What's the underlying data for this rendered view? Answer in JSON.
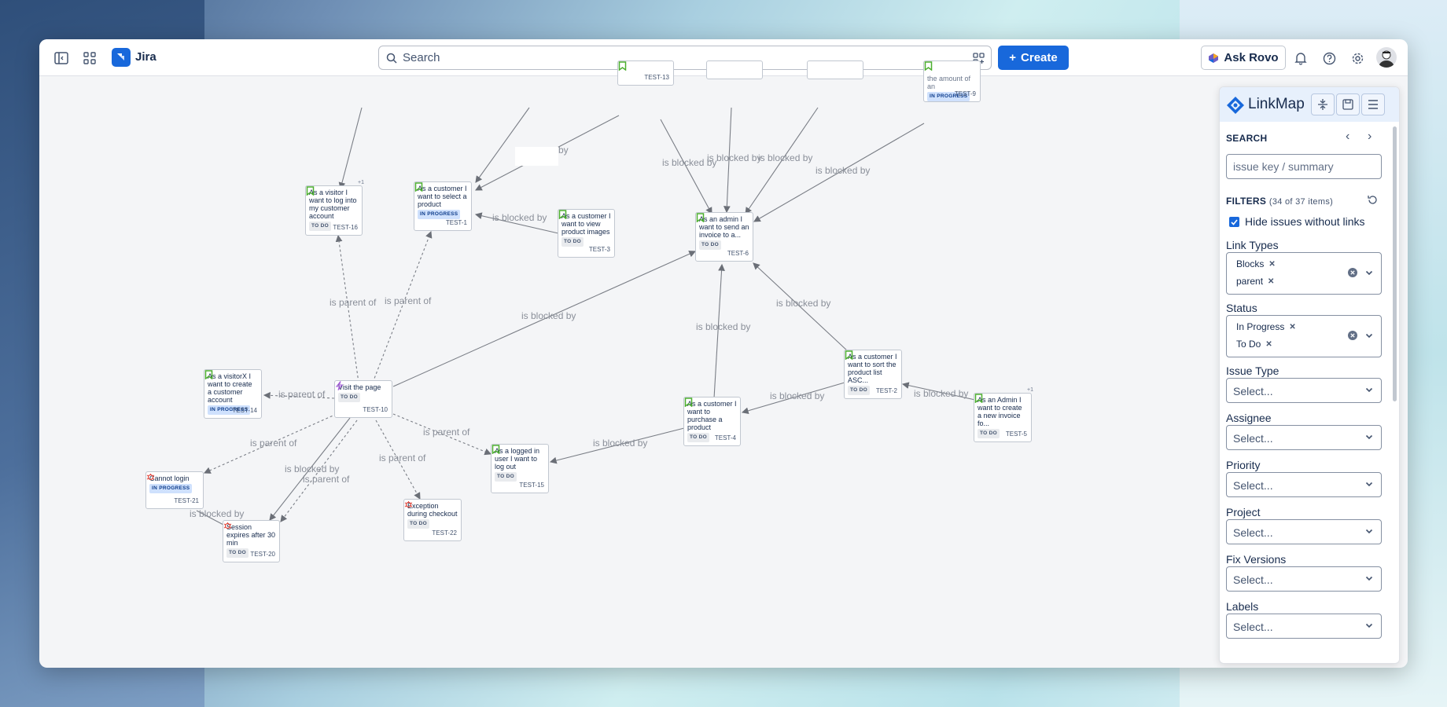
{
  "app": {
    "name": "Jira",
    "search_placeholder": "Search",
    "create_label": "Create",
    "ask_rovo_label": "Ask Rovo",
    "accent": "#1868db"
  },
  "icons": {
    "sidebar_toggle": "sidebar-toggle-icon",
    "apps": "app-switcher-icon",
    "search": "search-icon",
    "filter": "search-filter-icon",
    "notifications": "bell-icon",
    "help": "help-icon",
    "settings": "gear-icon"
  },
  "graph": {
    "nodes": [
      {
        "key": "TEST-13",
        "title": "",
        "status": ""
      },
      {
        "key": "TEST-9",
        "title": "the amount of an",
        "status": "IN PROGRESS"
      },
      {
        "key": "TEST-16",
        "title": "As a visitor I want to log into my customer account",
        "status": "TO DO",
        "badge": "+1"
      },
      {
        "key": "TEST-1",
        "title": "As a customer I want to select a product",
        "status": "IN PROGRESS"
      },
      {
        "key": "TEST-3",
        "title": "As a customer I want to view product images",
        "status": "TO DO"
      },
      {
        "key": "TEST-6",
        "title": "As an admin I want to send an invoice to a...",
        "status": "TO DO"
      },
      {
        "key": "TEST-14",
        "title": "As a visitorX I want to create a customer account",
        "status": "IN PROGRESS"
      },
      {
        "key": "TEST-10",
        "title": "Visit the page",
        "status": "TO DO"
      },
      {
        "key": "TEST-2",
        "title": "As a customer I want to sort the product list ASC...",
        "status": "TO DO"
      },
      {
        "key": "TEST-4",
        "title": "As a customer I want to purchase a product",
        "status": "TO DO"
      },
      {
        "key": "TEST-5",
        "title": "As an Admin I want to create a new invoice fo...",
        "status": "TO DO",
        "badge": "+1"
      },
      {
        "key": "TEST-15",
        "title": "As a logged in user I want to log out",
        "status": "TO DO"
      },
      {
        "key": "TEST-21",
        "title": "Cannot login",
        "status": "IN PROGRESS"
      },
      {
        "key": "TEST-20",
        "title": "Session expires after 30 min",
        "status": "TO DO"
      },
      {
        "key": "TEST-22",
        "title": "Exception during checkout",
        "status": "TO DO"
      }
    ],
    "edge_labels": {
      "blocked": "is blocked by",
      "parent": "is parent of",
      "by": "by"
    }
  },
  "linkmap": {
    "title": "LinkMap",
    "search_label": "SEARCH",
    "search_placeholder": "issue key / summary",
    "filters_label": "FILTERS",
    "filters_count": "(34 of 37 items)",
    "hide_without_links": "Hide issues without links",
    "link_types_label": "Link Types",
    "link_types": [
      "Blocks",
      "parent"
    ],
    "status_label": "Status",
    "statuses": [
      "In Progress",
      "To Do"
    ],
    "issue_type_label": "Issue Type",
    "assignee_label": "Assignee",
    "priority_label": "Priority",
    "project_label": "Project",
    "fix_versions_label": "Fix Versions",
    "labels_label": "Labels",
    "select_placeholder": "Select..."
  }
}
